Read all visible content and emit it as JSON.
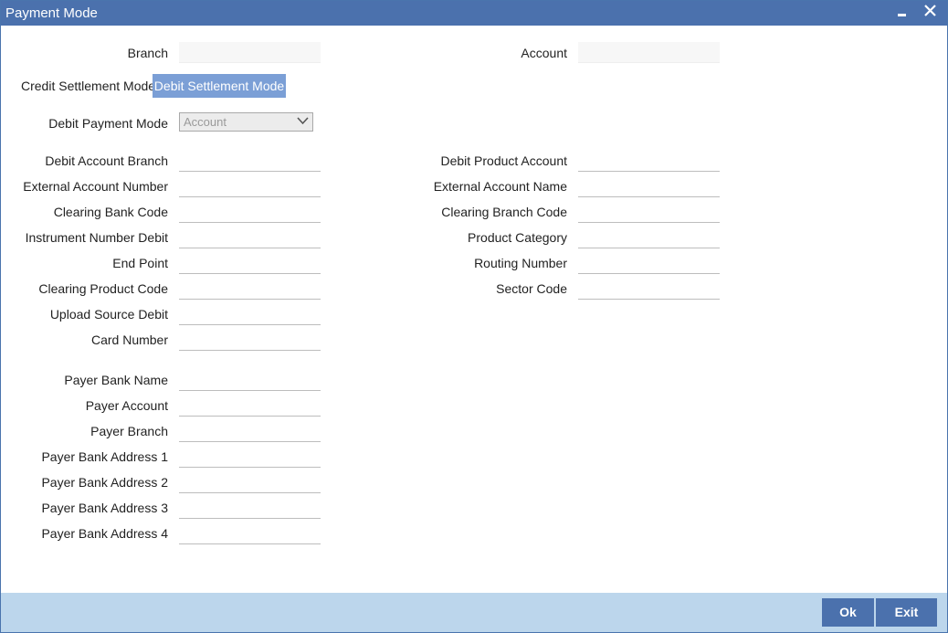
{
  "window": {
    "title": "Payment Mode"
  },
  "header": {
    "branch_label": "Branch",
    "account_label": "Account"
  },
  "tabs": [
    {
      "label": "Credit Settlement Mode",
      "active": false
    },
    {
      "label": "Debit Settlement Mode",
      "active": true
    }
  ],
  "debit_payment_mode": {
    "label": "Debit Payment Mode",
    "value": "Account"
  },
  "left_fields": [
    {
      "label": "Debit Account Branch",
      "value": ""
    },
    {
      "label": "External Account Number",
      "value": ""
    },
    {
      "label": "Clearing Bank Code",
      "value": ""
    },
    {
      "label": "Instrument Number Debit",
      "value": ""
    },
    {
      "label": "End Point",
      "value": ""
    },
    {
      "label": "Clearing Product Code",
      "value": ""
    },
    {
      "label": "Upload Source Debit",
      "value": ""
    },
    {
      "label": "Card Number",
      "value": ""
    }
  ],
  "right_fields": [
    {
      "label": "Debit Product Account",
      "value": ""
    },
    {
      "label": "External Account Name",
      "value": ""
    },
    {
      "label": "Clearing Branch Code",
      "value": ""
    },
    {
      "label": "Product Category",
      "value": ""
    },
    {
      "label": "Routing Number",
      "value": ""
    },
    {
      "label": "Sector Code",
      "value": ""
    }
  ],
  "payer_fields": [
    {
      "label": "Payer Bank Name",
      "value": ""
    },
    {
      "label": "Payer Account",
      "value": ""
    },
    {
      "label": "Payer Branch",
      "value": ""
    },
    {
      "label": "Payer Bank Address 1",
      "value": ""
    },
    {
      "label": "Payer Bank Address 2",
      "value": ""
    },
    {
      "label": "Payer Bank Address 3",
      "value": ""
    },
    {
      "label": "Payer Bank Address 4",
      "value": ""
    }
  ],
  "footer": {
    "ok_label": "Ok",
    "exit_label": "Exit"
  },
  "icons": {
    "minimize": "minimize-icon",
    "close": "close-icon",
    "dropdown": "chevron-down-icon"
  },
  "colors": {
    "titlebar": "#4b71ad",
    "active_tab": "#7b9fd6",
    "footer": "#bcd6ec",
    "button": "#4b71ad"
  }
}
